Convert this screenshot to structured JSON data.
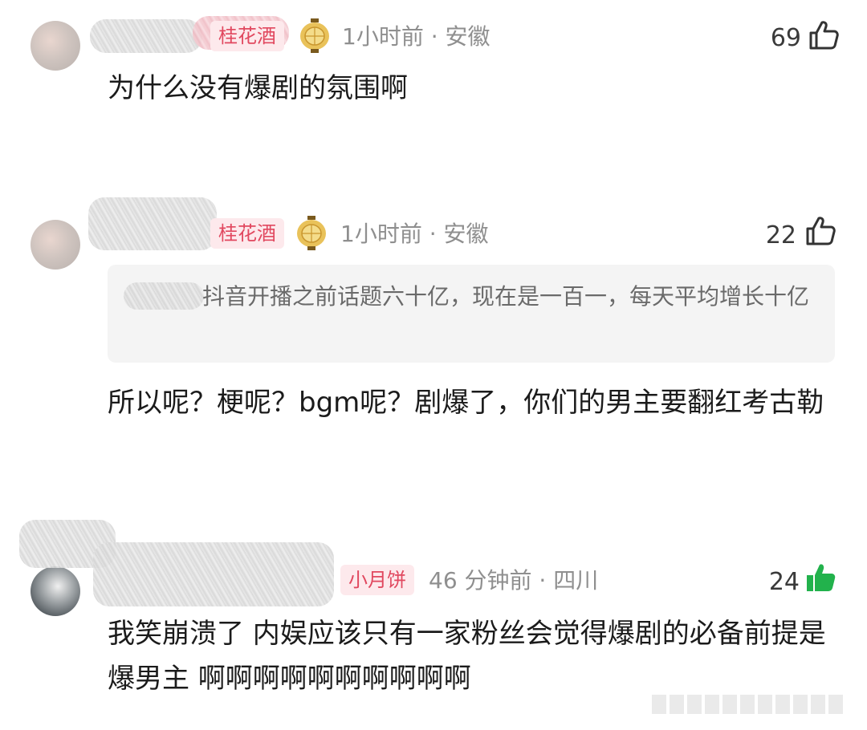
{
  "comments": [
    {
      "badge": "桂花酒",
      "meta": "1小时前 · 安徽",
      "likes": "69",
      "liked": false,
      "text": "为什么没有爆剧的氛围啊"
    },
    {
      "badge": "桂花酒",
      "meta": "1小时前 · 安徽",
      "likes": "22",
      "liked": false,
      "quote": "抖音开播之前话题六十亿，现在是一百一，每天平均增长十亿",
      "text": "所以呢？梗呢？bgm呢？剧爆了，你们的男主要翻红考古勒"
    },
    {
      "badge": "小月饼",
      "meta": "46 分钟前 · 四川",
      "likes": "24",
      "liked": true,
      "text": "我笑崩溃了 内娱应该只有一家粉丝会觉得爆剧的必备前提是爆男主 啊啊啊啊啊啊啊啊啊啊"
    }
  ],
  "icons": {
    "like": "thumbs-up-icon",
    "liked": "thumbs-up-filled-icon",
    "level": "lantern-icon"
  },
  "colors": {
    "badge_bg": "#fde9ec",
    "badge_text": "#e1485f",
    "liked_green": "#22b24c",
    "meta_gray": "#8f8f8f"
  }
}
